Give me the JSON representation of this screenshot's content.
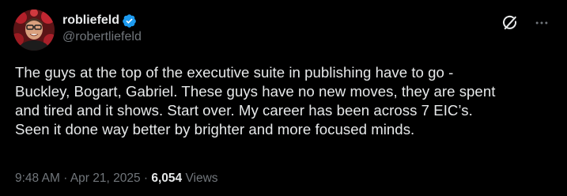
{
  "author": {
    "display_name": "robliefeld",
    "handle": "@robertliefeld",
    "verified": true,
    "verified_color": "#1d9bf0",
    "avatar_icon": "avatar-icon"
  },
  "actions": {
    "grok_icon": "grok-icon",
    "more_icon": "more-icon"
  },
  "body": {
    "lines": [
      "The guys at the top of the executive suite in publishing have to go -",
      "Buckley, Bogart, Gabriel. These guys have no new moves, they are spent",
      "and tired and it shows. Start over. My career has been across 7 EIC’s.",
      "Seen it done way better by brighter and more focused minds."
    ]
  },
  "meta": {
    "time": "9:48 AM",
    "separator": "·",
    "date": "Apr 21, 2025",
    "views_count": "6,054",
    "views_label": "Views"
  },
  "colors": {
    "background": "#000000",
    "text_primary": "#e7e9ea",
    "text_secondary": "#71767b"
  }
}
